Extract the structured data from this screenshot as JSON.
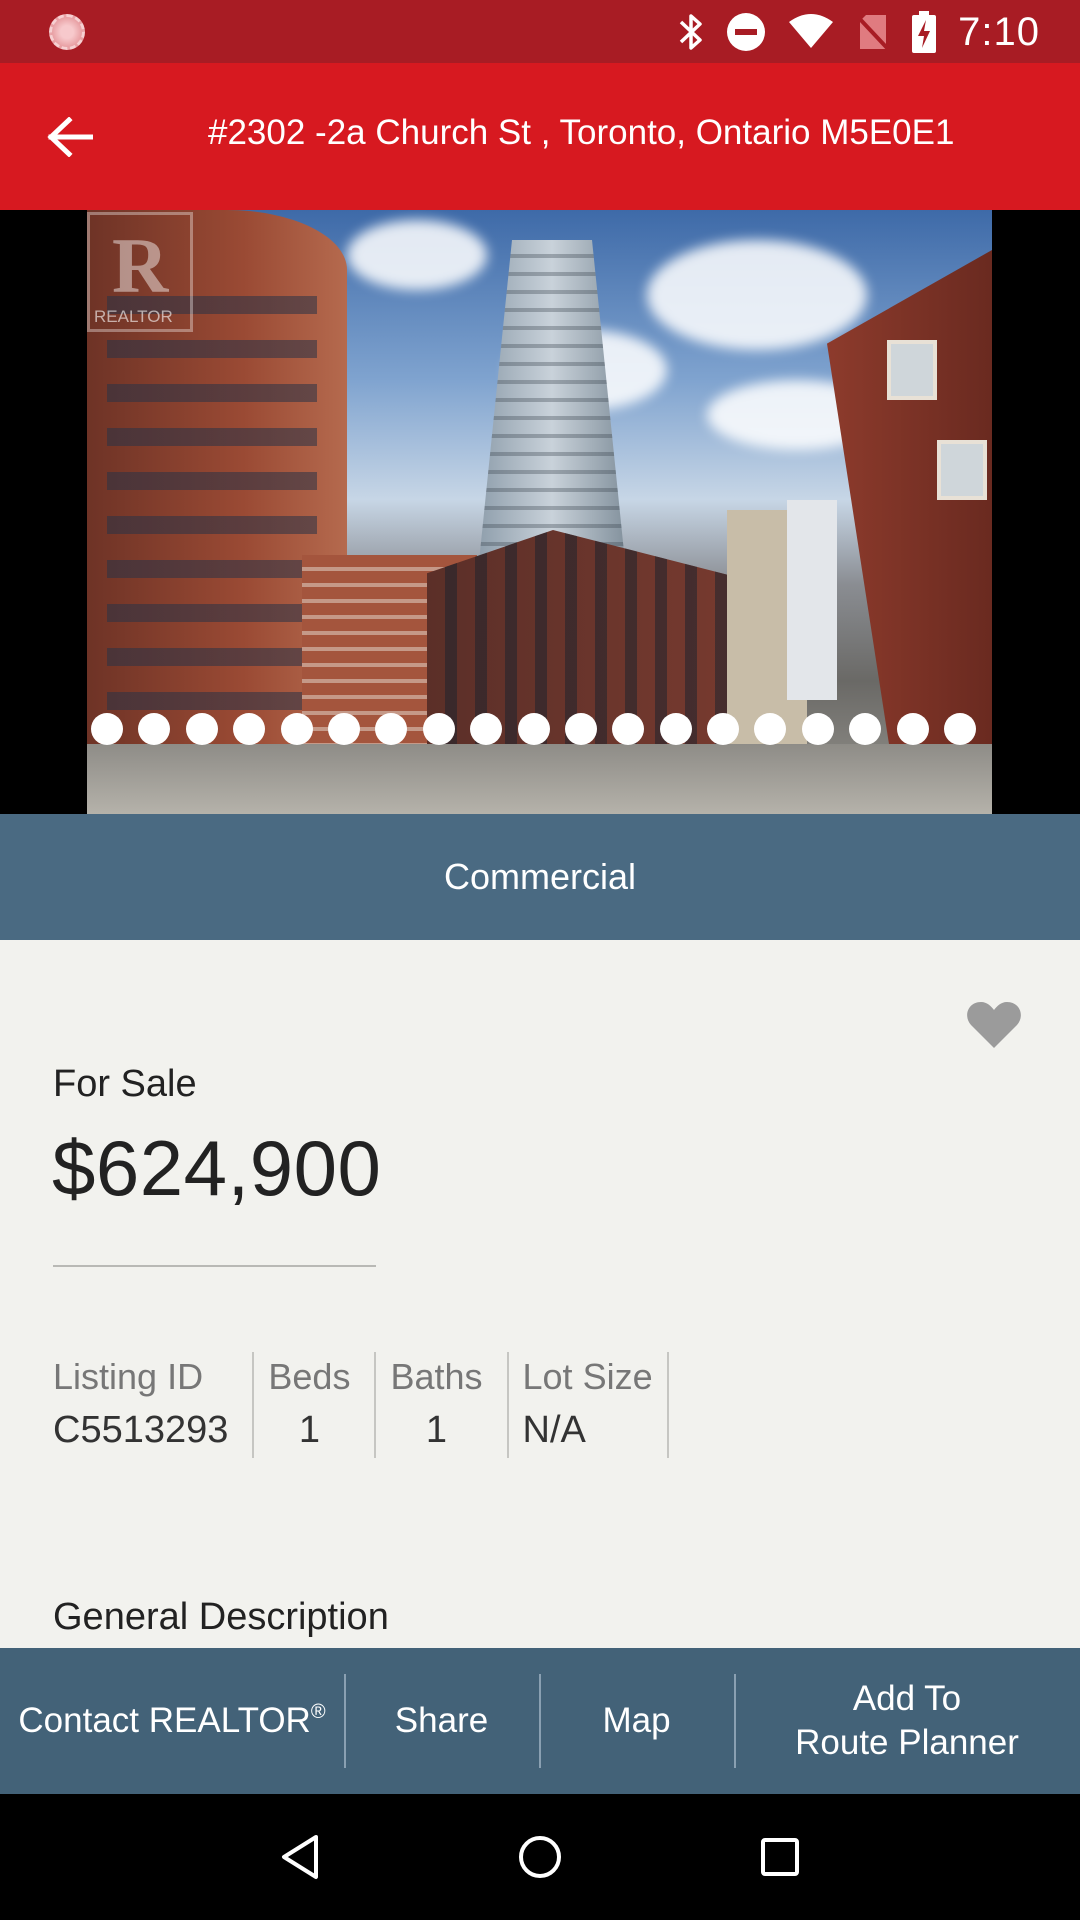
{
  "status_bar": {
    "time": "7:10",
    "icons": [
      "notification-icon",
      "bluetooth-icon",
      "do-not-disturb-icon",
      "wifi-icon",
      "no-sim-icon",
      "battery-charging-icon"
    ]
  },
  "app_bar": {
    "title": "#2302 -2a Church St , Toronto, Ontario M5E0E1",
    "back_icon": "arrow-back-icon"
  },
  "gallery": {
    "watermark": "REALTOR",
    "photo_count": 19,
    "selected_index": 0
  },
  "category": "Commercial",
  "listing": {
    "status": "For Sale",
    "price": "$624,900",
    "favorite_icon": "heart-icon",
    "stats": [
      {
        "label": "Listing ID",
        "value": "C5513293"
      },
      {
        "label": "Beds",
        "value": "1"
      },
      {
        "label": "Baths",
        "value": "1"
      },
      {
        "label": "Lot Size",
        "value": "N/A"
      }
    ],
    "section_title": "General Description"
  },
  "actions": {
    "contact": "Contact REALTOR",
    "contact_mark": "®",
    "share": "Share",
    "map": "Map",
    "route_line1": "Add To",
    "route_line2": "Route Planner"
  },
  "nav": [
    "back-triangle-icon",
    "home-circle-icon",
    "recents-square-icon"
  ],
  "colors": {
    "status_bar": "#a81c24",
    "app_bar": "#d71920",
    "category_band": "#4a6a82",
    "action_bar": "#436278",
    "background": "#f2f2ee"
  }
}
